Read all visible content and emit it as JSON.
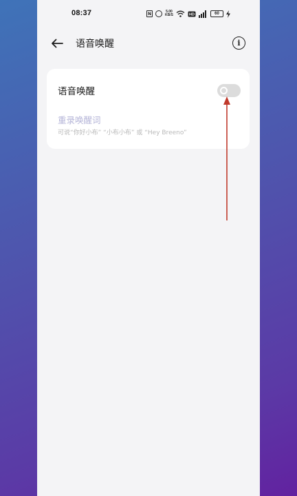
{
  "status_bar": {
    "time": "08:37",
    "net_speed_value": "5.00",
    "net_speed_unit": "KB/S",
    "battery_level": "60",
    "icons": [
      "nfc-icon",
      "alarm-icon",
      "network-speed",
      "wifi-icon",
      "hd-icon",
      "signal-icon",
      "battery-icon",
      "charging-icon"
    ]
  },
  "header": {
    "title": "语音唤醒",
    "back_icon": "back-arrow-icon",
    "info_icon": "info-icon",
    "info_glyph": "i"
  },
  "settings": {
    "voice_wakeup": {
      "label": "语音唤醒",
      "enabled": false
    },
    "rerecord": {
      "title": "重录唤醒词",
      "description": "可说“你好小布” “小布小布” 或 “Hey Breeno”",
      "disabled": true
    }
  },
  "colors": {
    "background_gradient_start": "#3f73b8",
    "background_gradient_end": "#6222a0",
    "screen_background": "#f4f4f6",
    "card_background": "#ffffff",
    "toggle_off": "#dcdcdc",
    "disabled_title": "#b5b5d8",
    "annotation_arrow": "#c0392b"
  }
}
